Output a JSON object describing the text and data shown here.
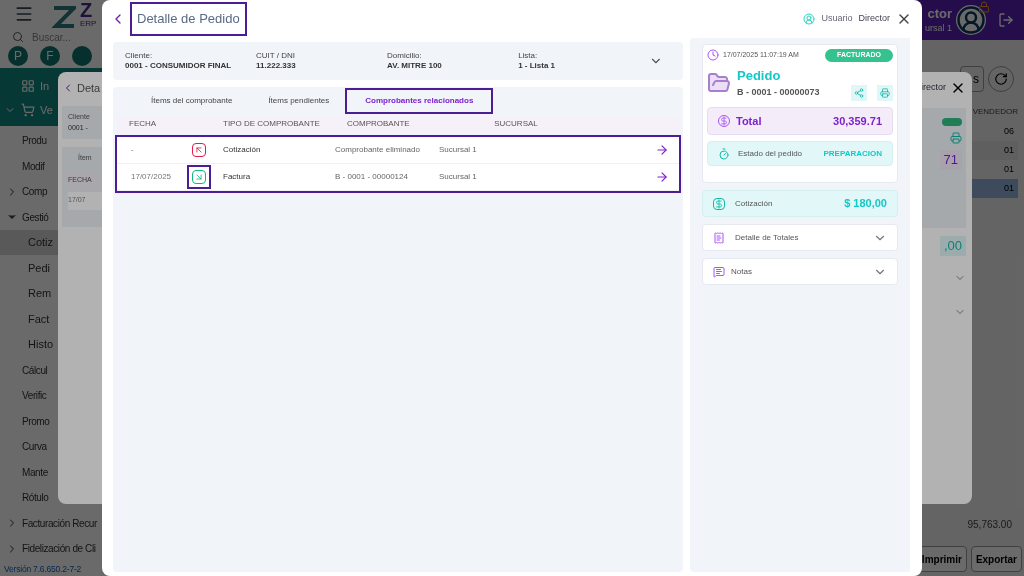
{
  "background": {
    "logo": {
      "title": "Z",
      "subtitle": "ERP"
    },
    "search_placeholder": "Buscar...",
    "quick_buttons": [
      "P",
      "F"
    ],
    "modules": [
      {
        "kind": "dashboard",
        "label": "In"
      },
      {
        "kind": "cart",
        "label": "Ve",
        "expanded": true
      }
    ],
    "sidebar": [
      {
        "label": "Produ"
      },
      {
        "label": "Modif"
      },
      {
        "label": "Comp",
        "expanded": false
      },
      {
        "label": "Gestió",
        "expanded": true,
        "children": [
          {
            "label": "Cotiz",
            "selected": true
          },
          {
            "label": "Pedi",
            "selected": false
          },
          {
            "label": "Rem",
            "selected": false
          },
          {
            "label": "Fact",
            "selected": false
          },
          {
            "label": "Histo",
            "selected": false
          }
        ]
      },
      {
        "label": "Cálcul"
      },
      {
        "label": "Verific"
      },
      {
        "label": "Promo"
      },
      {
        "label": "Curva"
      },
      {
        "label": "Mante"
      },
      {
        "label": "Rótulo"
      },
      {
        "label": "Facturación Recur",
        "expanded": false
      },
      {
        "label": "Fidelización de Cli",
        "expanded": false
      }
    ],
    "version": "Versión 7.6.650.2-7-2",
    "user": {
      "name": "ctor",
      "branch": "ursal 1"
    },
    "toolbar_button": "s",
    "column": "VENDEDOR",
    "rows": [
      {
        "value": "06",
        "selected": false
      },
      {
        "value": "01",
        "selected": false
      },
      {
        "value": "01",
        "selected": false
      },
      {
        "value": "01",
        "selected": true
      }
    ],
    "total": "95,763.00",
    "buttons": [
      "Imprimir",
      "Exportar"
    ]
  },
  "back_modal": {
    "title": "Deta",
    "client_label": "Cliente",
    "client_value": "0001 -",
    "tab": "Ítem",
    "column": "FECHA",
    "date": "17/07",
    "user": "irector",
    "total": "71",
    "quote_total": ",00"
  },
  "modal": {
    "title": "Detalle de Pedido",
    "title_highlighted": true,
    "user_label": "Usuario",
    "user_role": "Director",
    "info": [
      {
        "label": "Cliente:",
        "value": "0001 - CONSUMIDOR FINAL"
      },
      {
        "label": "CUIT / DNI",
        "value": "11.222.333"
      },
      {
        "label": "Domicilio:",
        "value": "AV. MITRE 100"
      },
      {
        "label": "Lista:",
        "value": "1 - Lista 1"
      }
    ],
    "tabs": [
      {
        "label": "Ítems del comprobante",
        "selected": false,
        "highlighted": false
      },
      {
        "label": "Ítems pendientes",
        "selected": false,
        "highlighted": false
      },
      {
        "label": "Comprobantes relacionados",
        "selected": true,
        "highlighted": true
      }
    ],
    "table": {
      "columns": [
        "FECHA",
        "TIPO DE COMPROBANTE",
        "COMPROBANTE",
        "SUCURSAL"
      ],
      "rows_highlighted": true,
      "rows": [
        {
          "date": "-",
          "kind": "outgoing",
          "icon_highlighted": false,
          "type": "Cotización",
          "number": "Comprobante eliminado",
          "branch": "Sucursal 1"
        },
        {
          "date": "17/07/2025",
          "kind": "incoming",
          "icon_highlighted": true,
          "type": "Factura",
          "number": "B - 0001 - 00000124",
          "branch": "Sucursal 1"
        }
      ]
    },
    "summary": {
      "datetime": "17/07/2025 11:07:19 AM",
      "status": "FACTURADO",
      "doc_type": "Pedido",
      "number": "B - 0001 - 00000073",
      "total_label": "Total",
      "total": "30,359.71",
      "state_label": "Estado del pedido",
      "state": "PREPARACION",
      "quote_label": "Cotización",
      "quote_total": "$ 180,00",
      "sections": [
        {
          "kind": "totals",
          "label": "Detalle de Totales",
          "expanded": false
        },
        {
          "kind": "notes",
          "label": "Notas",
          "expanded": false
        }
      ]
    }
  }
}
